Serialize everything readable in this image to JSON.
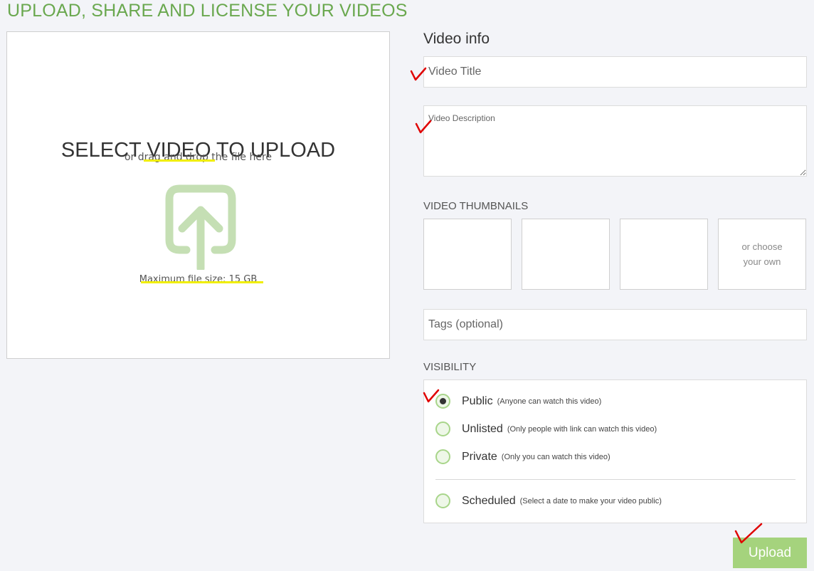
{
  "page_title": "UPLOAD, SHARE AND LICENSE YOUR VIDEOS",
  "drop_zone": {
    "title": "SELECT VIDEO TO UPLOAD",
    "subtitle": "or drag and drop the file here",
    "max_size": "Maximum file size: 15 GB",
    "icon": "upload-arrow-icon"
  },
  "video_info": {
    "heading": "Video info",
    "title_placeholder": "Video Title",
    "description_placeholder": "Video Description"
  },
  "thumbnails": {
    "label": "VIDEO THUMBNAILS",
    "choose_own": "or choose your own"
  },
  "tags": {
    "placeholder": "Tags (optional)"
  },
  "visibility": {
    "label": "VISIBILITY",
    "options": [
      {
        "name": "Public",
        "desc": "(Anyone can watch this video)",
        "checked": true
      },
      {
        "name": "Unlisted",
        "desc": "(Only people with link can watch this video)",
        "checked": false
      },
      {
        "name": "Private",
        "desc": "(Only you can watch this video)",
        "checked": false
      },
      {
        "name": "Scheduled",
        "desc": "(Select a date to make your video public)",
        "checked": false
      }
    ]
  },
  "upload_button": "Upload",
  "colors": {
    "accent": "#6aa84f",
    "button": "#a5d37d",
    "highlight": "#f0ee00",
    "checkmark": "#e00000"
  }
}
